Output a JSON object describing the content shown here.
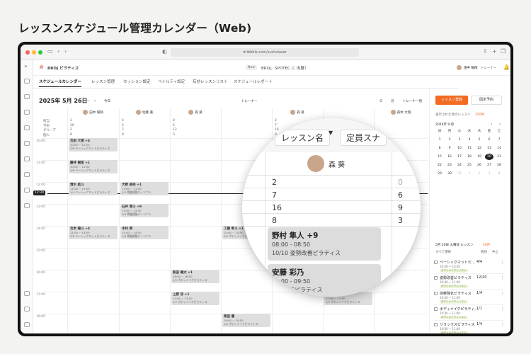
{
  "page_title": "レッスンスケジュール管理カレンダー（Web)",
  "browser": {
    "url": "dribbble.com/sushoiazar"
  },
  "app": {
    "brand": "BROJ ピラティス",
    "notice_badge": "New",
    "notice": "BROJ、SPOTEC に 出展！",
    "user": "田中 陽翔",
    "role": "トレーナー"
  },
  "tabs": [
    "スケジュールカレンダー",
    "レッスン管理",
    "セッション設定",
    "ペナルティ設定",
    "有効レッスンリスト",
    "スケジュールレポート"
  ],
  "calendar": {
    "date": "2025年 5月 26日",
    "today": "今日",
    "view_toggle": "トレーナー",
    "view_options": [
      "日",
      "週"
    ],
    "trainer_view": "トレーナー別",
    "now_time": "12:30",
    "row_labels": [
      "担当",
      "予約",
      "グループ",
      "個人"
    ],
    "trainers": [
      {
        "name": "田中 陽翔",
        "v": [
          "3",
          "20",
          "2",
          "8"
        ]
      },
      {
        "name": "佐藤 蓮",
        "v": [
          "4",
          "5",
          "2",
          "8"
        ]
      },
      {
        "name": "森 葵",
        "v": [
          "0",
          "5",
          "12",
          "5"
        ]
      },
      {
        "name": "",
        "v": [
          "",
          "",
          "",
          ""
        ]
      },
      {
        "name": "森 葵",
        "v": [
          "2",
          "7",
          "16",
          "8"
        ]
      },
      {
        "name": "",
        "v": [
          "",
          "",
          "",
          ""
        ]
      },
      {
        "name": "森本 大翔",
        "v": [
          "",
          "",
          "",
          ""
        ]
      }
    ],
    "times": [
      "10:00",
      "11:00",
      "12:00",
      "13:00",
      "14:00",
      "15:00",
      "16:00",
      "17:00",
      "18:00"
    ],
    "events": [
      {
        "name": "吉田 大翔 +4",
        "time": "10:00 ~ 10:50",
        "desc": "2/8 ベーシックマットピラティス"
      },
      {
        "name": "藤井 樹里 +1",
        "time": "10:00 ~ 11:50",
        "desc": "3/8 ベーシックマットピラティス"
      },
      {
        "name": "清水 結斗",
        "time": "11:00 ~ 11:50",
        "desc": "1/4 ベーシックマットピラティス"
      },
      {
        "name": "大野 美咲 +1",
        "time": "11:00 ~ 11:50",
        "desc": "2/2 骨盤調整パーソナル"
      },
      {
        "name": "石井 湊斗 +9",
        "time": "13:00 ~ 13:50",
        "desc": "3/8 骨盤調整パーソナル"
      },
      {
        "name": "吉本 陽斗 +4",
        "time": "14:00 ~ 14:50",
        "desc": "3/8 ベーシックマットピラティス"
      },
      {
        "name": "木村 葵",
        "time": "14:00 ~ 14:50",
        "desc": "2/8 骨盤調整パーソナル"
      },
      {
        "name": "工藤 隼斗 +1",
        "time": "14:00 ~ 14:50",
        "desc": "2/2 ボディメイクピラティス"
      },
      {
        "name": "新田 颯太 +1",
        "time": "16:00 ~ 16:50",
        "desc": "1/1 ボディメイクピラティス"
      },
      {
        "name": "上野 涼 +1",
        "time": "17:00 ~ 17:50",
        "desc": "1/1 ボディメイクピラティス"
      },
      {
        "name": "三浦 晴翔 +1",
        "time": "17:00 ~ 17:50",
        "desc": "1/1 ボディメイクピラティス"
      },
      {
        "name": "柴田 優",
        "time": "18:00 ~ 18:50",
        "desc": "1/2 ボディメイクピラティス"
      }
    ]
  },
  "magnifier": {
    "header1": "レッスン名",
    "header2": "定員スナ",
    "trainer": "森 葵",
    "values": [
      "2",
      "7",
      "16",
      "8"
    ],
    "side": [
      "0",
      "6",
      "9",
      "3"
    ],
    "ev1": {
      "name": "野村 隼人 +9",
      "time": "08:00 - 08:50",
      "desc": "10/10 姿勢改善ピラティス"
    },
    "ev2": {
      "name": "安藤 彩乃",
      "time": "09:00 - 09:50",
      "desc": "姿勢改善ピラティス"
    }
  },
  "right": {
    "add_lesson": "レッスン登録",
    "fixed": "固定予約",
    "today_label": "表示された月のレッスン",
    "today_count": "350件",
    "month": "2024年 9 月",
    "weekdays": [
      "日",
      "月",
      "火",
      "水",
      "木",
      "金",
      "土"
    ],
    "days": [
      "1",
      "2",
      "3",
      "4",
      "5",
      "6",
      "7",
      "8",
      "9",
      "10",
      "11",
      "12",
      "13",
      "14",
      "15",
      "16",
      "17",
      "18",
      "19",
      "20",
      "21",
      "22",
      "23",
      "24",
      "25",
      "26",
      "27",
      "28",
      "29",
      "30",
      "31",
      "1",
      "2",
      "3",
      "4"
    ],
    "selected": "20",
    "list_header": "5月 20日 火曜日 レッスン",
    "list_count": "26件",
    "select_all": "すべて選択",
    "delete": "削除",
    "stop": "中止",
    "lessons": [
      {
        "name": "ベーシックマットピ…",
        "count": "4/4",
        "time": "10:00 ~ 10:50",
        "tag": "ボディメイクレッスン"
      },
      {
        "name": "姿勢改善ピラティス",
        "count": "12/20",
        "time": "10:00 ~ 11:00",
        "tag": "ボディメイクレッスン"
      },
      {
        "name": "体幹強化ピラティス",
        "count": "1/4",
        "time": "10:00 ~ 11:00",
        "tag": "ボディメイクレッスン"
      },
      {
        "name": "ボディメイクピラティ…",
        "count": "1/1",
        "time": "10:00 ~ 11:00",
        "tag": "ボディメイクレッスン"
      },
      {
        "name": "リラックスピラティス",
        "count": "1/4",
        "time": "10:00 ~ 11:00",
        "tag": "ボディメイクレッスン"
      }
    ]
  }
}
